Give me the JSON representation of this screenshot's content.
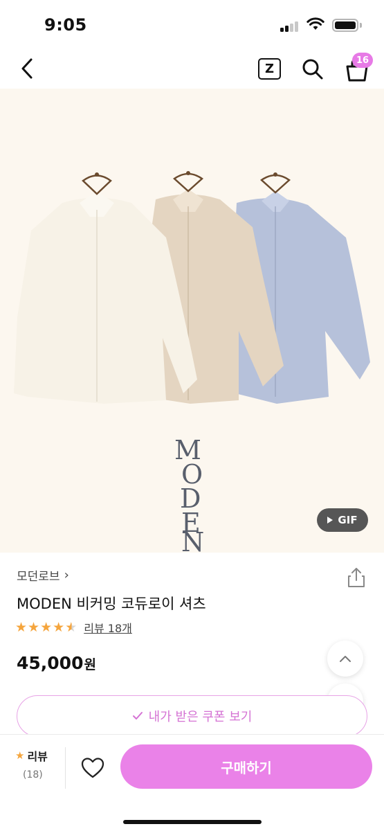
{
  "status_bar": {
    "time": "9:05"
  },
  "nav": {
    "back_icon": "chevron-left-icon",
    "z_label": "Z",
    "cart_badge": "16",
    "accent_color": "#e77ae6"
  },
  "hero": {
    "gif_label": "GIF",
    "brand_watermark_letters": [
      "M",
      "O",
      "D",
      "E",
      "N"
    ],
    "shirt_colors": [
      "#f6f1e6",
      "#e5d6c2",
      "#b7c2da"
    ]
  },
  "product": {
    "brand": "모던로브",
    "title": "MODEN 비커밍 코듀로이 셔츠",
    "rating": 4.5,
    "review_link": "리뷰 18개",
    "price": "45,000",
    "currency": "원"
  },
  "coupon": {
    "label": "내가 받은 쿠폰 보기"
  },
  "bottom_bar": {
    "review_label": "리뷰",
    "review_count": "(18)",
    "buy_label": "구매하기",
    "buy_color": "#ea82e8"
  }
}
